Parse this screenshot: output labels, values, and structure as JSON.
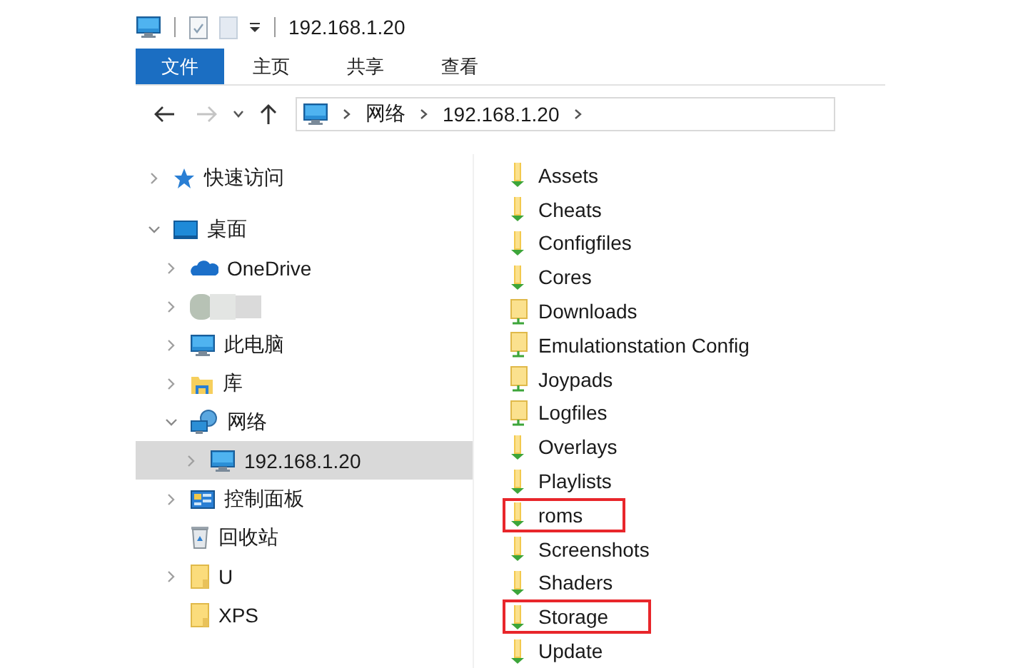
{
  "window": {
    "title": "192.168.1.20"
  },
  "ribbon_tabs": [
    {
      "label": "文件",
      "selected": true
    },
    {
      "label": "主页",
      "selected": false
    },
    {
      "label": "共享",
      "selected": false
    },
    {
      "label": "查看",
      "selected": false
    }
  ],
  "navigation": {
    "back": {
      "disabled": false
    },
    "forward": {
      "disabled": true
    }
  },
  "address_bar": {
    "breadcrumbs": [
      "网络",
      "192.168.1.20"
    ]
  },
  "sidebar": {
    "items": [
      {
        "label": "快速访问",
        "kind": "star",
        "expandable": true,
        "expanded": false,
        "selected": false
      },
      {
        "label": "桌面",
        "kind": "desktop",
        "expandable": true,
        "expanded": true,
        "selected": false,
        "children": [
          {
            "label": "OneDrive",
            "kind": "cloud",
            "expandable": true,
            "expanded": false,
            "selected": false
          },
          {
            "kind": "blurred",
            "expandable": true,
            "expanded": false,
            "selected": false
          },
          {
            "label": "此电脑",
            "kind": "computer",
            "expandable": true,
            "expanded": false,
            "selected": false
          },
          {
            "label": "库",
            "kind": "library",
            "expandable": true,
            "expanded": false,
            "selected": false
          },
          {
            "label": "网络",
            "kind": "network",
            "expandable": true,
            "expanded": true,
            "selected": false,
            "children": [
              {
                "label": "192.168.1.20",
                "kind": "computer",
                "expandable": true,
                "expanded": false,
                "selected": true
              }
            ]
          },
          {
            "label": "控制面板",
            "kind": "control-panel",
            "expandable": true,
            "expanded": false,
            "selected": false
          },
          {
            "label": "回收站",
            "kind": "recycle-bin",
            "expandable": false,
            "expanded": false,
            "selected": false
          },
          {
            "label": "U",
            "kind": "folder",
            "expandable": true,
            "expanded": false,
            "selected": false
          },
          {
            "label": "XPS",
            "kind": "folder",
            "expandable": false,
            "expanded": false,
            "selected": false
          }
        ]
      }
    ]
  },
  "folders": [
    {
      "name": "Assets",
      "kind": "shared",
      "highlighted": false
    },
    {
      "name": "Cheats",
      "kind": "shared",
      "highlighted": false
    },
    {
      "name": "Configfiles",
      "kind": "shared",
      "highlighted": false
    },
    {
      "name": "Cores",
      "kind": "shared",
      "highlighted": false
    },
    {
      "name": "Downloads",
      "kind": "network",
      "highlighted": false
    },
    {
      "name": "Emulationstation Config",
      "kind": "network",
      "highlighted": false
    },
    {
      "name": "Joypads",
      "kind": "network",
      "highlighted": false
    },
    {
      "name": "Logfiles",
      "kind": "network",
      "highlighted": false
    },
    {
      "name": "Overlays",
      "kind": "shared",
      "highlighted": false
    },
    {
      "name": "Playlists",
      "kind": "shared",
      "highlighted": false
    },
    {
      "name": "roms",
      "kind": "shared",
      "highlighted": true
    },
    {
      "name": "Screenshots",
      "kind": "shared",
      "highlighted": false
    },
    {
      "name": "Shaders",
      "kind": "shared",
      "highlighted": false
    },
    {
      "name": "Storage",
      "kind": "shared",
      "highlighted": true
    },
    {
      "name": "Update",
      "kind": "shared",
      "highlighted": false
    }
  ]
}
